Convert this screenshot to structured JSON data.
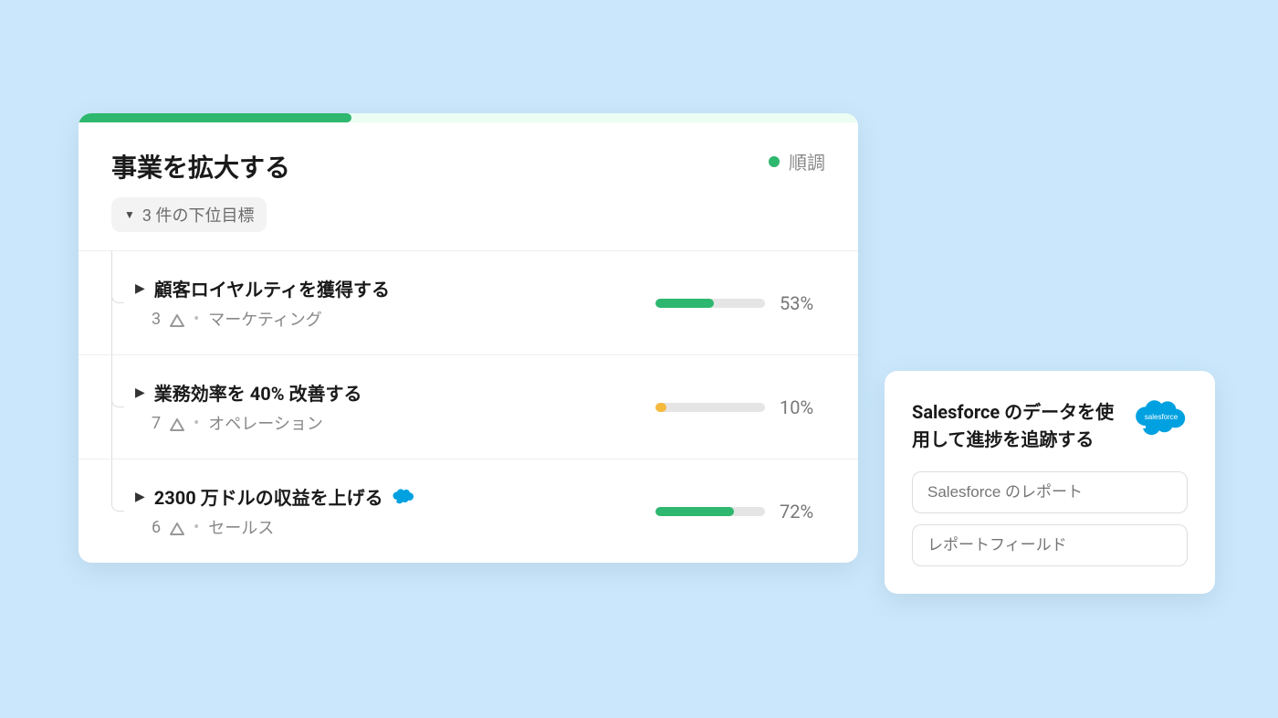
{
  "main": {
    "title": "事業を拡大する",
    "subgoals_label": "3 件の下位目標",
    "status_text": "順調",
    "status_color": "#2eb76f",
    "header_progress_pct": 35
  },
  "goals": [
    {
      "title": "顧客ロイヤルティを獲得する",
      "count": "3",
      "category": "マーケティング",
      "progress_pct": 53,
      "progress_label": "53%",
      "bar_color": "#2eb76f",
      "has_sf_icon": false
    },
    {
      "title": "業務効率を 40% 改善する",
      "count": "7",
      "category": "オペレーション",
      "progress_pct": 10,
      "progress_label": "10%",
      "bar_color": "#f5b93e",
      "has_sf_icon": false
    },
    {
      "title": "2300 万ドルの収益を上げる",
      "count": "6",
      "category": "セールス",
      "progress_pct": 72,
      "progress_label": "72%",
      "bar_color": "#2eb76f",
      "has_sf_icon": true
    }
  ],
  "side": {
    "title": "Salesforce のデータを使用して進捗を追跡する",
    "inputs": [
      {
        "placeholder": "Salesforce のレポート"
      },
      {
        "placeholder": "レポートフィールド"
      }
    ],
    "logo_text": "salesforce"
  }
}
